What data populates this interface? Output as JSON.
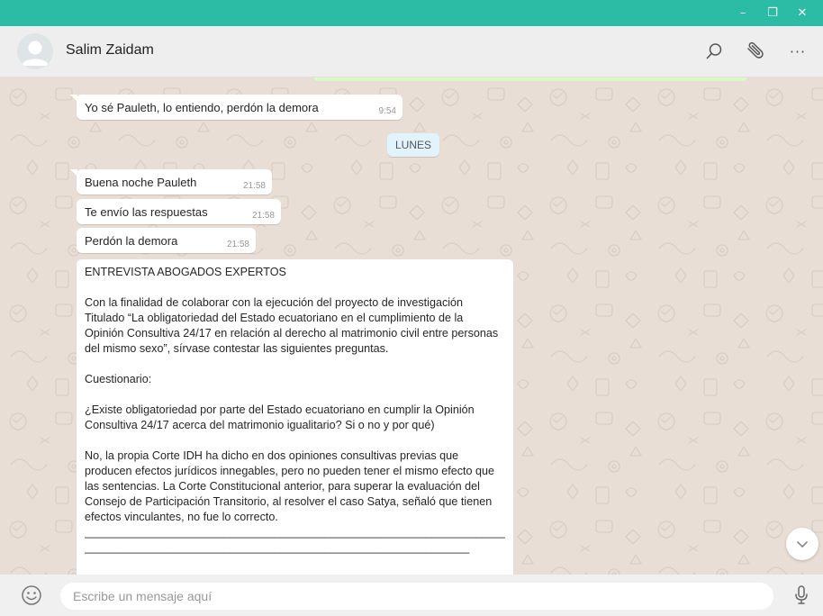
{
  "window": {
    "minimize_glyph": "–",
    "restore_glyph": "❐",
    "close_glyph": "✕"
  },
  "header": {
    "contact_name": "Salim Zaidam",
    "icons": [
      "search-icon",
      "paperclip-icon",
      "more-icon"
    ],
    "more_glyph": "···"
  },
  "chat": {
    "messages_before": [
      {
        "text": "Yo sé Pauleth, lo entiendo, perdón la demora",
        "time": "9:54"
      }
    ],
    "date_divider": "LUNES",
    "messages_after": [
      {
        "text": "Buena noche Pauleth",
        "time": "21:58"
      },
      {
        "text": "Te envío las respuestas",
        "time": "21:58"
      },
      {
        "text": "Perdón la demora",
        "time": "21:58"
      }
    ],
    "long_message": {
      "title": "ENTREVISTA ABOGADOS EXPERTOS",
      "intro": "Con la finalidad de colaborar con la ejecución del proyecto de investigación Titulado “La obligatoriedad del Estado ecuatoriano en el cumplimiento de la Opinión Consultiva 24/17 en relación al derecho al matrimonio civil entre personas del mismo sexo”, sírvase contestar las siguientes preguntas.",
      "section": "Cuestionario:",
      "question": "¿Existe obligatoriedad por parte del Estado ecuatoriano en cumplir la Opinión Consultiva 24/17 acerca del matrimonio igualitario? Si o no y por qué)",
      "answer": "No, la propia Corte IDH ha dicho en dos opiniones consultivas previas que producen efectos jurídicos innegables, pero no pueden tener el mismo efecto que las sentencias. La Corte Constitucional anterior, para superar la evaluación del Consejo de Participación Transitorio, al resolver el caso Satya, señaló que tienen efectos vinculantes, no fue lo correcto.",
      "rule1": "_____________________________________________________________________",
      "rule2": "_____________________________________________________________"
    }
  },
  "composer": {
    "placeholder": "Escribe un mensaje aquí",
    "icons": [
      "emoji-icon",
      "microphone-icon"
    ]
  },
  "colors": {
    "titlebar": "#2cbba5",
    "chat_bg": "#e8ded5",
    "incoming_bubble": "#ffffff",
    "outgoing_bubble": "#dcf8c6",
    "date_chip": "#e1f3fb"
  }
}
